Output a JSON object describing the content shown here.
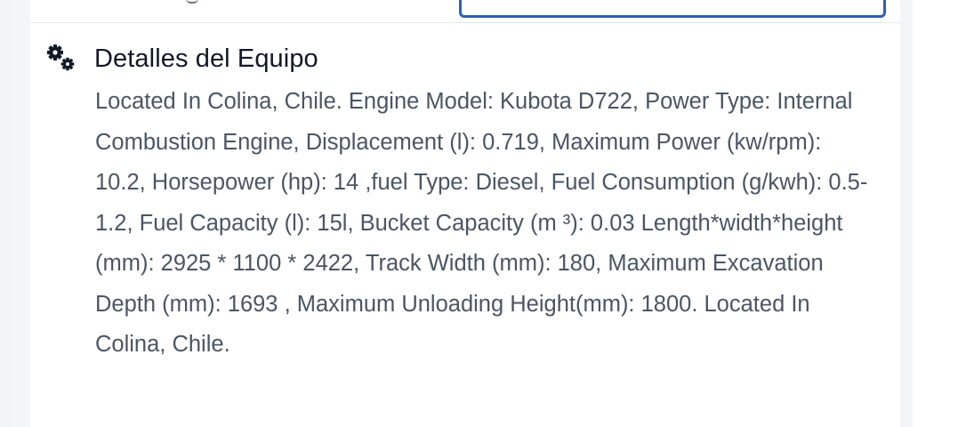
{
  "equipment_details": {
    "title": "Detalles del Equipo",
    "icon": "gears-icon",
    "description": "Located In Colina, Chile. Engine Model: Kubota D722, Power Type: Internal Combustion Engine, Displacement (l): 0.719, Maximum Power (kw/rpm): 10.2, Horsepower (hp): 14 ,fuel Type: Diesel, Fuel Consumption (g/kwh): 0.5-1.2, Fuel Capacity (l): 15l, Bucket Capacity (m ³): 0.03 Length*width*height (mm): 2925 * 1100 * 2422, Track Width (mm): 180, Maximum Excavation Depth (mm): 1693 , Maximum Unloading Height(mm): 1800. Located In Colina, Chile."
  },
  "colors": {
    "focus_border": "#2f5fb3",
    "title_text": "#111827",
    "body_text": "#4b5563"
  }
}
